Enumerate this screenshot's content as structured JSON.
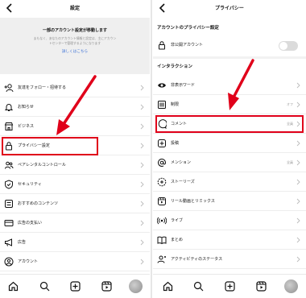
{
  "left": {
    "header": {
      "title": "設定"
    },
    "notice": {
      "title": "一部のアカウント設定が移動します",
      "description": "まもなく、あなたのアカウント情報と設定は、主にアカウントセンターで管理するようになります",
      "link": "詳しくはこちら"
    },
    "items": [
      {
        "label": "友達をフォロー・招待する",
        "icon": "add-person-icon"
      },
      {
        "label": "お知らせ",
        "icon": "bell-icon"
      },
      {
        "label": "ビジネス",
        "icon": "shop-icon"
      },
      {
        "label": "プライバシー設定",
        "icon": "lock-icon"
      },
      {
        "label": "ペアレンタルコントロール",
        "icon": "people-icon"
      },
      {
        "label": "セキュリティ",
        "icon": "shield-icon"
      },
      {
        "label": "おすすめのコンテンツ",
        "icon": "checklist-icon"
      },
      {
        "label": "広告の支払い",
        "icon": "card-icon"
      },
      {
        "label": "広告",
        "icon": "megaphone-icon"
      },
      {
        "label": "アカウント",
        "icon": "account-icon"
      }
    ]
  },
  "right": {
    "header": {
      "title": "プライバシー"
    },
    "account_section": "アカウントのプライバシー設定",
    "private_account": {
      "label": "非公開アカウント",
      "enabled": false
    },
    "interaction_section": "インタラクション",
    "items": [
      {
        "label": "非表示ワード",
        "value": "",
        "icon": "eye-icon"
      },
      {
        "label": "制限",
        "value": "オフ",
        "icon": "restrict-icon"
      },
      {
        "label": "コメント",
        "value": "全員",
        "icon": "comment-icon"
      },
      {
        "label": "投稿",
        "value": "",
        "icon": "add-post-icon"
      },
      {
        "label": "メンション",
        "value": "全員",
        "icon": "at-icon"
      },
      {
        "label": "ストーリーズ",
        "value": "",
        "icon": "story-icon"
      },
      {
        "label": "リール動画とリミックス",
        "value": "",
        "icon": "reels-icon"
      },
      {
        "label": "ライブ",
        "value": "",
        "icon": "live-icon"
      },
      {
        "label": "まとめ",
        "value": "",
        "icon": "book-icon"
      },
      {
        "label": "アクティビティのステータス",
        "value": "",
        "icon": "activity-icon"
      }
    ]
  },
  "tabs": [
    "home-icon",
    "search-icon",
    "new-post-icon",
    "reels-icon",
    "profile-avatar"
  ],
  "colors": {
    "highlight": "#e0001a",
    "link": "#3a70d6",
    "notice_bg": "#efefef"
  }
}
